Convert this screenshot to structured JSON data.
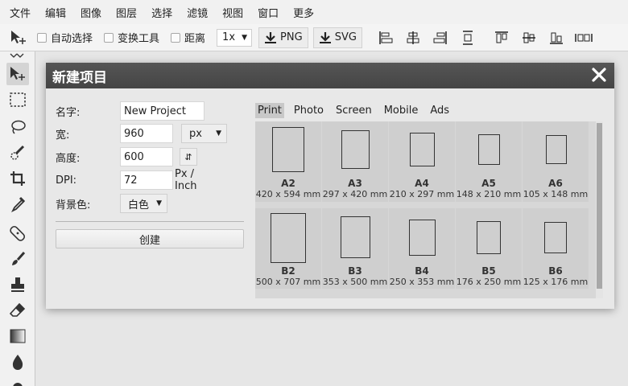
{
  "menu": [
    "文件",
    "编辑",
    "图像",
    "图层",
    "选择",
    "滤镜",
    "视图",
    "窗口",
    "更多"
  ],
  "toolbar": {
    "auto_select": "自动选择",
    "transform_tools": "变换工具",
    "distance": "距离",
    "zoom": "1x",
    "png": "PNG",
    "svg": "SVG"
  },
  "dialog": {
    "title": "新建项目",
    "name_label": "名字:",
    "name_value": "New Project",
    "width_label": "宽:",
    "width_value": "960",
    "unit": "px",
    "height_label": "高度:",
    "height_value": "600",
    "swap": "⇵",
    "dpi_label": "DPI:",
    "dpi_value": "72",
    "dpi_unit": "Px / Inch",
    "bg_label": "背景色:",
    "bg_value": "白色",
    "create": "创建"
  },
  "tabs": [
    "Print",
    "Photo",
    "Screen",
    "Mobile",
    "Ads"
  ],
  "presets": [
    {
      "name": "A2",
      "dims": "420 x 594 mm"
    },
    {
      "name": "A3",
      "dims": "297 x 420 mm"
    },
    {
      "name": "A4",
      "dims": "210 x 297 mm"
    },
    {
      "name": "A5",
      "dims": "148 x 210 mm"
    },
    {
      "name": "A6",
      "dims": "105 x 148 mm"
    },
    {
      "name": "B2",
      "dims": "500 x 707 mm"
    },
    {
      "name": "B3",
      "dims": "353 x 500 mm"
    },
    {
      "name": "B4",
      "dims": "250 x 353 mm"
    },
    {
      "name": "B5",
      "dims": "176 x 250 mm"
    },
    {
      "name": "B6",
      "dims": "125 x 176 mm"
    }
  ]
}
